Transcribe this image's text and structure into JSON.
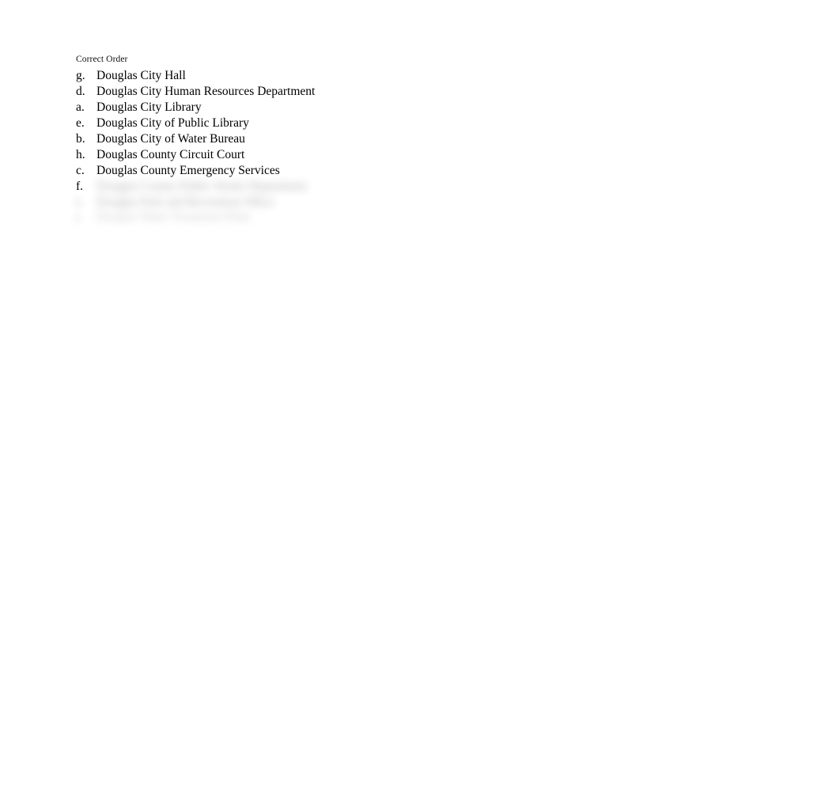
{
  "document": {
    "background_color": "#ffffff",
    "text_color": "#000000",
    "heading": "Correct Order"
  },
  "list": {
    "items": [
      {
        "marker": "g.",
        "label": "Douglas City Hall",
        "redacted": false
      },
      {
        "marker": "d.",
        "label": "Douglas City Human Resources Department",
        "redacted": false
      },
      {
        "marker": "a.",
        "label": "Douglas City Library",
        "redacted": false
      },
      {
        "marker": "e.",
        "label": "Douglas City of Public Library",
        "redacted": false
      },
      {
        "marker": "b.",
        "label": "Douglas City of Water Bureau",
        "redacted": false
      },
      {
        "marker": "h.",
        "label": "Douglas County Circuit Court",
        "redacted": false
      },
      {
        "marker": "c.",
        "label": "Douglas County Emergency Services",
        "redacted": false
      }
    ],
    "redacted_items": [
      {
        "marker": "f.",
        "label": "Douglas County Public Works Department",
        "marker_visible": true
      },
      {
        "marker": "i.",
        "label": "Douglas Park and Recreation Office",
        "marker_visible": false
      },
      {
        "marker": "j.",
        "label": "Douglas Water Treatment Plant",
        "marker_visible": false
      }
    ]
  }
}
